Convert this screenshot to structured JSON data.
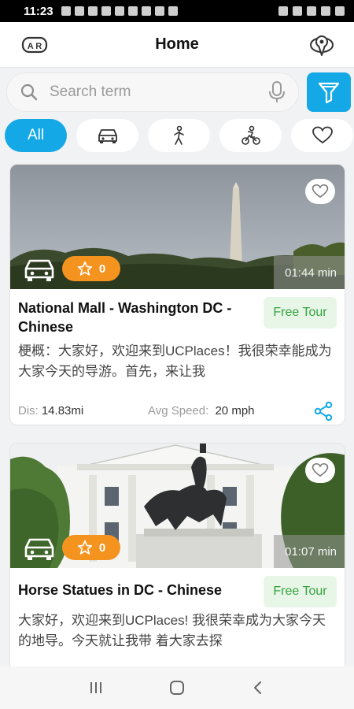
{
  "status_bar": {
    "time": "11:23"
  },
  "header": {
    "title": "Home"
  },
  "search": {
    "placeholder": "Search term"
  },
  "chips": [
    {
      "label": "All",
      "active": true
    },
    {
      "icon": "car-icon"
    },
    {
      "icon": "walk-icon"
    },
    {
      "icon": "bike-icon"
    },
    {
      "icon": "heart-icon"
    }
  ],
  "tours": [
    {
      "title": "National Mall - Washington DC - Chinese",
      "badge": "Free Tour",
      "description": "梗概：大家好，欢迎来到UCPlaces！我很荣幸能成为大家今天的导游。首先，来让我",
      "rating": "0",
      "duration": "01:44 min",
      "dis_label": "Dis:",
      "dis_value": "14.83mi",
      "speed_label": "Avg Speed:",
      "speed_value": "20 mph"
    },
    {
      "title": "Horse Statues in DC - Chinese",
      "badge": "Free Tour",
      "description": "大家好，欢迎来到UCPlaces! 我很荣幸成为大家今天的地导。今天就让我带 着大家去探",
      "rating": "0",
      "duration": "01:07 min"
    }
  ],
  "colors": {
    "accent": "#14a9e6",
    "rating": "#f5931f",
    "badge_text": "#34a33f"
  }
}
